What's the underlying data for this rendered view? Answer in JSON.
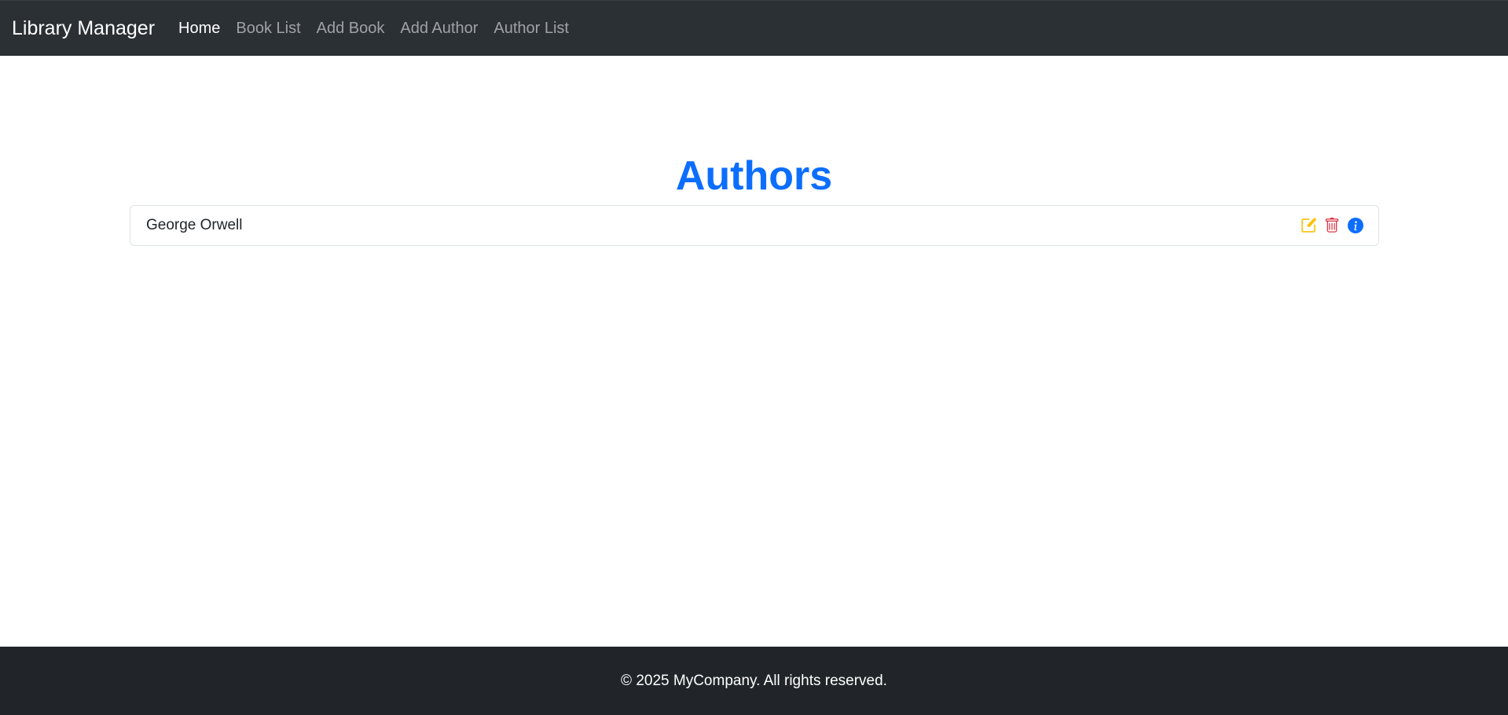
{
  "navbar": {
    "brand": "Library Manager",
    "links": [
      {
        "label": "Home",
        "active": true
      },
      {
        "label": "Book List",
        "active": false
      },
      {
        "label": "Add Book",
        "active": false
      },
      {
        "label": "Add Author",
        "active": false
      },
      {
        "label": "Author List",
        "active": false
      }
    ]
  },
  "main": {
    "title": "Authors",
    "authors": [
      {
        "name": "George Orwell",
        "actions": [
          {
            "icon": "edit-icon",
            "color": "#ffc107"
          },
          {
            "icon": "trash-icon",
            "color": "#dc3545"
          },
          {
            "icon": "info-icon",
            "color": "#0d6efd"
          }
        ]
      }
    ]
  },
  "footer": {
    "text": "© 2025 MyCompany. All rights reserved."
  },
  "colors": {
    "navbar_bg": "#2b3035",
    "footer_bg": "#212529",
    "accent": "#0d6efd",
    "warning": "#ffc107",
    "danger": "#dc3545"
  }
}
